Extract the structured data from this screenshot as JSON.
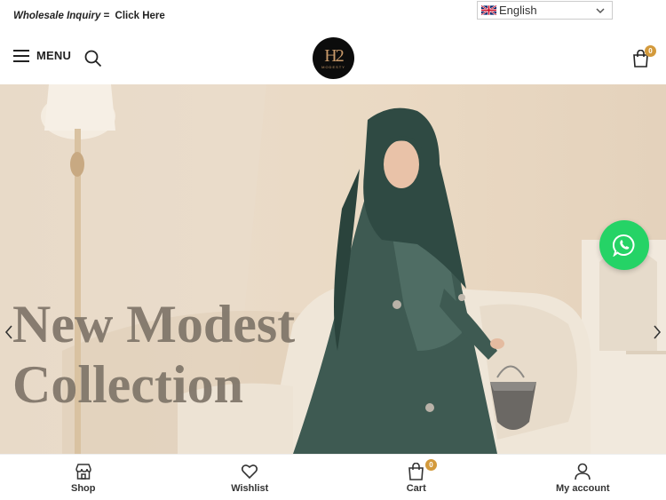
{
  "topbar": {
    "inquiry_text": "Wholesale Inquiry",
    "inquiry_sep": "=",
    "inquiry_cta": "Click Here",
    "language": {
      "selected": "English",
      "flag_icon": "uk-flag-icon"
    }
  },
  "header": {
    "menu_label": "MENU",
    "logo": {
      "mark": "H2",
      "sub": "MODESTY"
    },
    "cart_count": "0"
  },
  "hero": {
    "headline_line1": "New Modest",
    "headline_line2": "Collection"
  },
  "bottom_nav": {
    "items": [
      {
        "label": "Shop",
        "icon": "store-icon"
      },
      {
        "label": "Wishlist",
        "icon": "heart-icon"
      },
      {
        "label": "Cart",
        "icon": "cart-icon",
        "badge": "0"
      },
      {
        "label": "My account",
        "icon": "user-icon"
      }
    ]
  },
  "colors": {
    "accent_badge": "#d39a3c",
    "whatsapp": "#25d366",
    "headline": "#7f7569"
  }
}
